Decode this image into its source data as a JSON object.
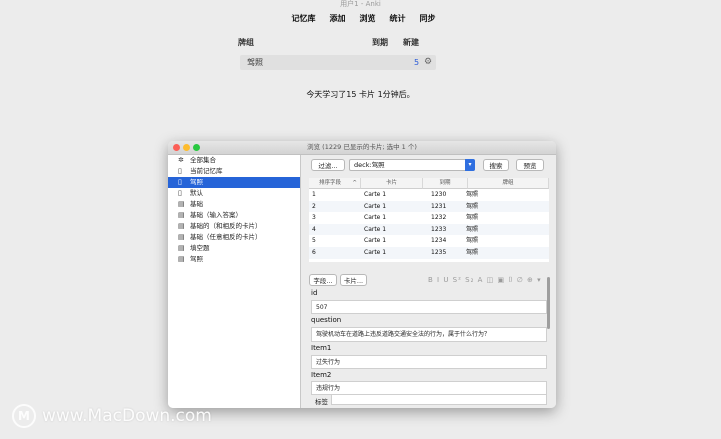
{
  "main_window": {
    "title": "用户1 - Anki",
    "toolbar": [
      "记忆库",
      "添加",
      "浏览",
      "统计",
      "同步"
    ],
    "deck_list": {
      "headers": {
        "deck": "牌组",
        "due": "到期",
        "new": "新建"
      },
      "rows": [
        {
          "name": "驾照",
          "due": "5"
        }
      ]
    },
    "studied_text": "今天学习了15 卡片 1分钟后。"
  },
  "browser": {
    "title": "浏览 (1229 已显示的卡片; 选中 1 个)",
    "sidebar": [
      {
        "icon": "star-icon",
        "glyph": "✲",
        "label": "全部集合"
      },
      {
        "icon": "deck-icon",
        "glyph": "▯",
        "label": "当前记忆库"
      },
      {
        "icon": "deck-icon",
        "glyph": "▯",
        "label": "驾照",
        "selected": true
      },
      {
        "icon": "deck-icon",
        "glyph": "▯",
        "label": "默认"
      },
      {
        "icon": "notetype-icon",
        "glyph": "▤",
        "label": "基础"
      },
      {
        "icon": "notetype-icon",
        "glyph": "▤",
        "label": "基础（输入答案）"
      },
      {
        "icon": "notetype-icon",
        "glyph": "▤",
        "label": "基础的（和相反的卡片）"
      },
      {
        "icon": "notetype-icon",
        "glyph": "▤",
        "label": "基础（任意相反的卡片）"
      },
      {
        "icon": "notetype-icon",
        "glyph": "▤",
        "label": "填空题"
      },
      {
        "icon": "notetype-icon",
        "glyph": "▤",
        "label": "驾照"
      }
    ],
    "filter_button": "过滤...",
    "search_value": "deck:驾照",
    "search_button": "搜索",
    "preview_button": "预览",
    "columns": [
      "排序字段",
      "卡片",
      "到期",
      "牌组"
    ],
    "rows": [
      [
        "1",
        "Carte 1",
        "1230",
        "驾照"
      ],
      [
        "2",
        "Carte 1",
        "1231",
        "驾照"
      ],
      [
        "3",
        "Carte 1",
        "1232",
        "驾照"
      ],
      [
        "4",
        "Carte 1",
        "1233",
        "驾照"
      ],
      [
        "5",
        "Carte 1",
        "1234",
        "驾照"
      ],
      [
        "6",
        "Carte 1",
        "1235",
        "驾照"
      ]
    ],
    "fields_button": "字段...",
    "cards_button": "卡片...",
    "format_icons": "B I U S² S₂ A ◫ ▣ ⌷ ∅ ⊕ ▾",
    "fields": [
      {
        "name": "id",
        "value": "507"
      },
      {
        "name": "question",
        "value": "驾驶机动车在道路上违反道路交通安全法的行为，属于什么行为？"
      },
      {
        "name": "Item1",
        "value": "过失行为"
      },
      {
        "name": "Item2",
        "value": "违规行为"
      }
    ],
    "tags_label": "标签"
  },
  "watermark": {
    "logo": "M",
    "text": "www.MacDown.com"
  }
}
